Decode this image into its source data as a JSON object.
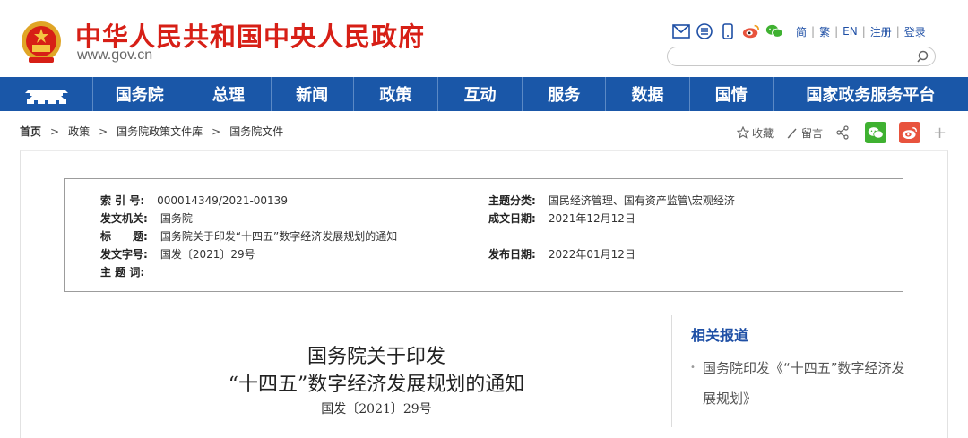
{
  "header": {
    "site_title": "中华人民共和国中央人民政府",
    "site_url": "www.gov.cn",
    "lang_links": [
      "简",
      "繁",
      "EN",
      "注册",
      "登录"
    ],
    "search": {
      "value": "",
      "placeholder": ""
    }
  },
  "toolbar_icons": [
    "mail-icon",
    "rss-icon",
    "mobile-icon",
    "weibo-icon",
    "wechat-icon"
  ],
  "nav": {
    "items": [
      "国务院",
      "总理",
      "新闻",
      "政策",
      "互动",
      "服务",
      "数据",
      "国情",
      "国家政务服务平台"
    ]
  },
  "breadcrumb": {
    "items": [
      "首页",
      "政策",
      "国务院政策文件库",
      "国务院文件"
    ],
    "separator": ">"
  },
  "page_tools": {
    "favorite": "收藏",
    "comment": "留言"
  },
  "meta": {
    "index_label": "索 引 号:",
    "index_value": "000014349/2021-00139",
    "topic_label": "主题分类:",
    "topic_value": "国民经济管理、国有资产监管\\宏观经济",
    "issuer_label": "发文机关:",
    "issuer_value": "国务院",
    "date_written_label": "成文日期:",
    "date_written_value": "2021年12月12日",
    "title_label": "标　　题:",
    "title_value": "国务院关于印发“十四五”数字经济发展规划的通知",
    "doc_number_label": "发文字号:",
    "doc_number_value": "国发〔2021〕29号",
    "published_label": "发布日期:",
    "published_value": "2022年01月12日",
    "keywords_label": "主 题 词:"
  },
  "document": {
    "title_line1": "国务院关于印发",
    "title_line2": "“十四五”数字经济发展规划的通知",
    "number": "国发〔2021〕29号"
  },
  "related": {
    "heading": "相关报道",
    "items": [
      "国务院印发《“十四五”数字经济发展规划》"
    ]
  },
  "colors": {
    "brand_red": "#d71f16",
    "nav_blue": "#1a57a8",
    "link_blue": "#1e4fa5",
    "wechat_green": "#3fb131",
    "weibo_red": "#e8533d"
  }
}
